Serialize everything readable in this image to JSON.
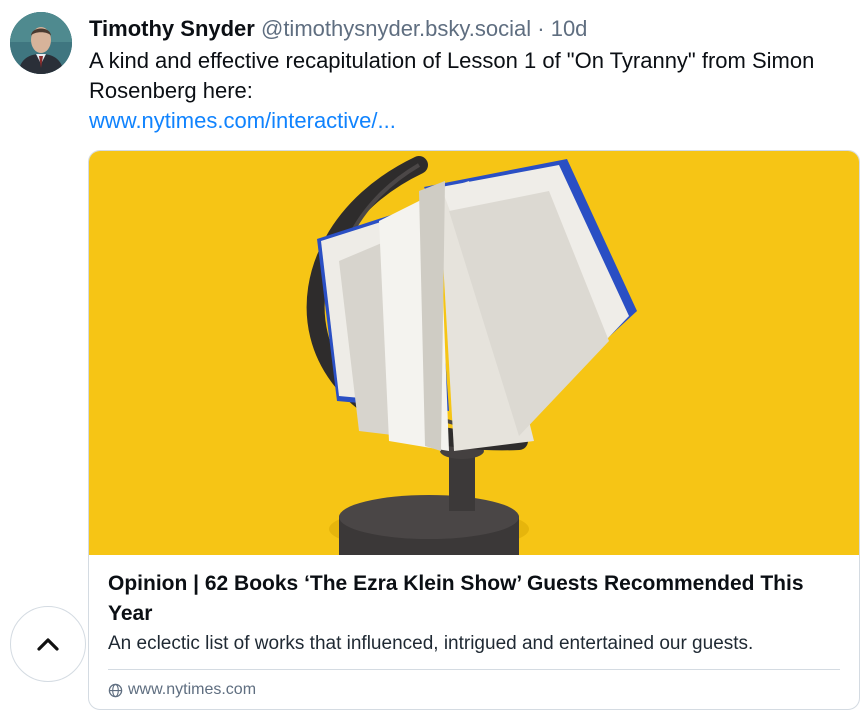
{
  "post": {
    "author_name": "Timothy Snyder",
    "author_handle": "@timothysnyder.bsky.social",
    "separator": "·",
    "time": "10d",
    "text": "A kind and effective recapitulation of Lesson 1 of \"On Tyranny\" from Simon Rosenberg here:",
    "link": "www.nytimes.com/interactive/..."
  },
  "card": {
    "image_icon": "book-on-globe-stand-image",
    "title": "Opinion | 62 Books ‘The Ezra Klein Show’ Guests Recommended This Year",
    "description": "An eclectic list of works that influenced, intrigued and entertained our guests.",
    "domain": "www.nytimes.com",
    "domain_icon": "globe-icon"
  },
  "controls": {
    "scroll_top_icon": "chevron-up-icon"
  },
  "colors": {
    "link": "#1083fe",
    "muted": "#5f6e80",
    "image_background": "#f6c515",
    "book_cover": "#2a4fc4",
    "border": "#d4dbe2"
  }
}
